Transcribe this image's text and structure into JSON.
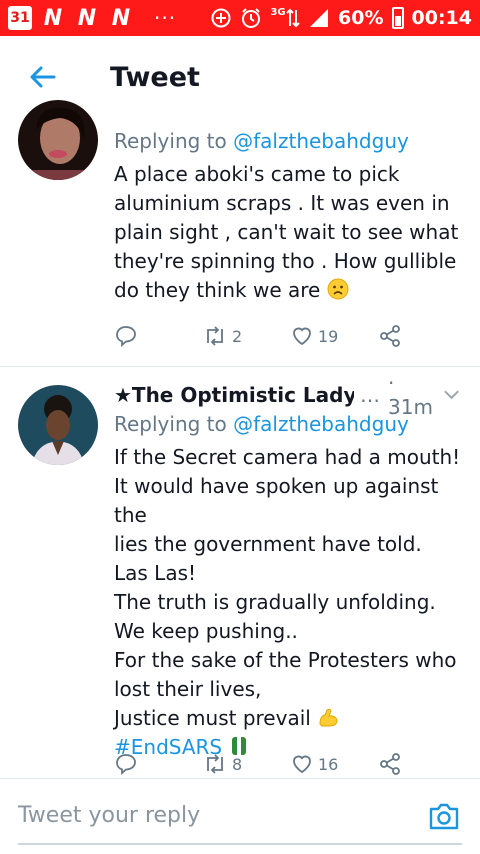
{
  "status_bar": {
    "calendar_day": "31",
    "notification_letters": [
      "N",
      "N",
      "N"
    ],
    "more": "···",
    "network": "3G",
    "battery": "60%",
    "time": "00:14"
  },
  "header": {
    "title": "Tweet"
  },
  "tweets": [
    {
      "replying_prefix": "Replying to ",
      "replying_to": "@falzthebahdguy",
      "lines": [
        "A place aboki's came to pick",
        "aluminium scraps . It was even in",
        "plain sight , can't wait to see what",
        "they're spinning tho . How gullible",
        "do they think we are"
      ],
      "retweets": "2",
      "likes": "19"
    },
    {
      "name": "★The Optimistic Lady★",
      "handle_truncated": "…",
      "time": "· 31m",
      "replying_prefix": "Replying to ",
      "replying_to": "@falzthebahdguy",
      "lines": [
        "If the Secret camera had a mouth!",
        "It would have spoken up against the",
        "lies the government have told.",
        "Las Las!",
        "The truth is gradually unfolding.",
        "We keep pushing..",
        "For the sake of the Protesters who",
        "lost their lives,",
        "Justice must prevail"
      ],
      "hashtag": "#EndSARS",
      "retweets": "8",
      "likes": "16"
    }
  ],
  "reply_bar": {
    "placeholder": "Tweet your reply"
  },
  "colors": {
    "accent": "#1b95e0",
    "status_bar": "#ff1a1a",
    "muted": "#657786"
  }
}
